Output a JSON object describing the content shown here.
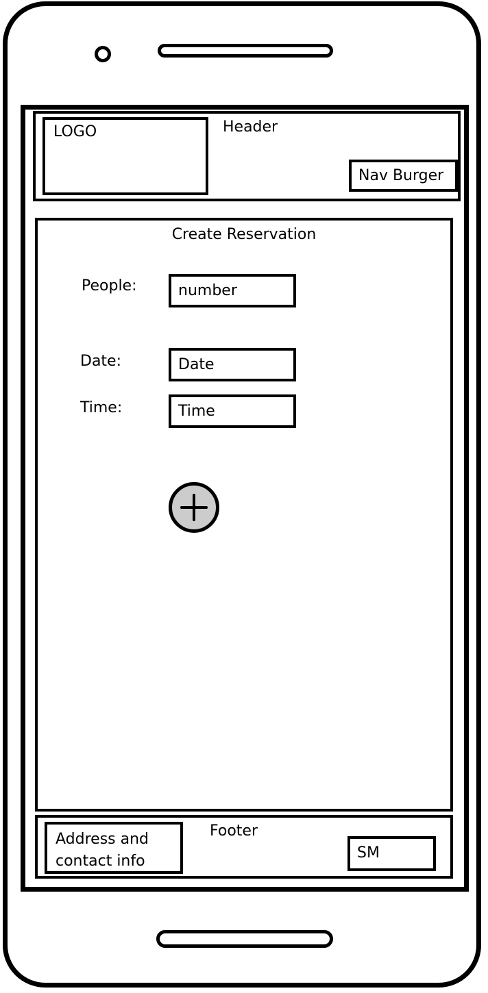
{
  "header": {
    "logo": "LOGO",
    "title": "Header",
    "nav_burger": "Nav Burger"
  },
  "main": {
    "title": "Create Reservation",
    "fields": [
      {
        "label": "People:",
        "value": "number"
      },
      {
        "label": "Date:",
        "value": "Date"
      },
      {
        "label": "Time:",
        "value": "Time"
      }
    ],
    "add_icon": "plus-icon"
  },
  "footer": {
    "address": "Address and contact info",
    "title": "Footer",
    "sm": "SM"
  },
  "colors": {
    "stroke": "#000000",
    "button_fill": "#cccccc",
    "background": "#ffffff"
  }
}
